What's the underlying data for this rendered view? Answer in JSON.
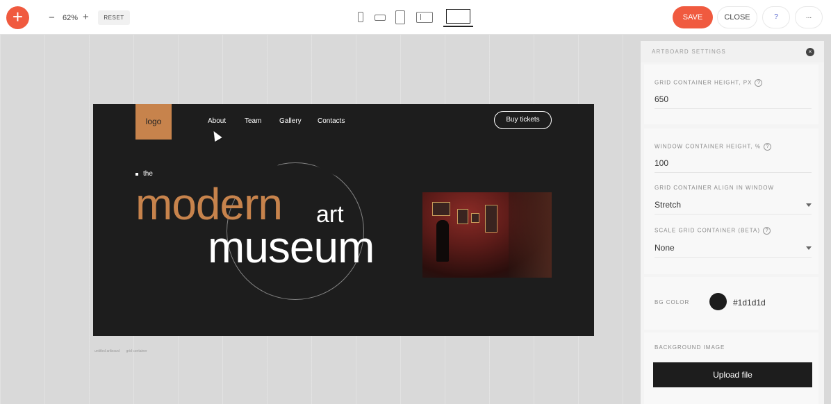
{
  "toolbar": {
    "add_label": "+",
    "zoom_minus": "−",
    "zoom_value": "62%",
    "zoom_plus": "+",
    "reset_label": "RESET",
    "devices": [
      "phone-portrait-icon",
      "phone-landscape-icon",
      "tablet-portrait-icon",
      "tablet-landscape-icon",
      "desktop-icon"
    ],
    "save_label": "SAVE",
    "close_label": "CLOSE",
    "help_label": "?",
    "more_label": "..."
  },
  "artboard": {
    "logo": "logo",
    "nav": [
      "About",
      "Team",
      "Gallery",
      "Contacts"
    ],
    "buy_label": "Buy tickets",
    "the_text": "the",
    "modern_text": "modern",
    "art_text": "art",
    "museum_text": "museum",
    "bg_color": "#1d1d1d",
    "accent_color": "#c7834c"
  },
  "breadcrumb": [
    "untitled artboard",
    "grid container"
  ],
  "panel": {
    "title": "ARTBOARD SETTINGS",
    "close_icon": "×",
    "grid_height_label": "GRID CONTAINER HEIGHT, PX",
    "grid_height_value": "650",
    "window_height_label": "WINDOW CONTAINER HEIGHT, %",
    "window_height_value": "100",
    "align_label": "GRID CONTAINER ALIGN IN WINDOW",
    "align_value": "Stretch",
    "scale_label": "SCALE GRID CONTAINER (BETA)",
    "scale_value": "None",
    "bg_color_label": "BG COLOR",
    "bg_color_value": "#1d1d1d",
    "bg_image_label": "BACKGROUND IMAGE",
    "upload_label": "Upload file",
    "help_mark": "?"
  },
  "colors": {
    "primary": "#f05a3f",
    "panel_bg": "#f4f4f4"
  }
}
